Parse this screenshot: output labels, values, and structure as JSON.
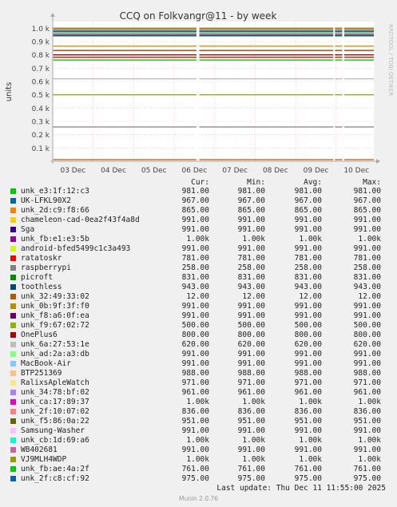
{
  "title": "CCQ on Folkvangr@11 - by week",
  "ylabel": "units",
  "side_text": "RRDTOOL / TOBI OETIKER",
  "legend_headers": {
    "cur": "Cur:",
    "min": "Min:",
    "avg": "Avg:",
    "max": "Max:"
  },
  "legend": [
    {
      "name": "unk_e3:1f:12:c3",
      "color": "#00cc00",
      "cur": "981.00",
      "min": "981.00",
      "avg": "981.00",
      "max": "981.00"
    },
    {
      "name": "UK-LFKL90X2",
      "color": "#0066b3",
      "cur": "967.00",
      "min": "967.00",
      "avg": "967.00",
      "max": "967.00"
    },
    {
      "name": "unk_2d:c9:f8:66",
      "color": "#ff8000",
      "cur": "865.00",
      "min": "865.00",
      "avg": "865.00",
      "max": "865.00"
    },
    {
      "name": "chameleon-cad-0ea2f43f4a8d",
      "color": "#ffcc00",
      "cur": "991.00",
      "min": "991.00",
      "avg": "991.00",
      "max": "991.00"
    },
    {
      "name": "Sga",
      "color": "#330099",
      "cur": "991.00",
      "min": "991.00",
      "avg": "991.00",
      "max": "991.00"
    },
    {
      "name": "unk_fb:e1:e3:5b",
      "color": "#990099",
      "cur": "1.00k",
      "min": "1.00k",
      "avg": "1.00k",
      "max": "1.00k"
    },
    {
      "name": "android-bfed5499c1c3a493",
      "color": "#ccff00",
      "cur": "991.00",
      "min": "991.00",
      "avg": "991.00",
      "max": "991.00"
    },
    {
      "name": "ratatoskr",
      "color": "#ff0000",
      "cur": "781.00",
      "min": "781.00",
      "avg": "781.00",
      "max": "781.00"
    },
    {
      "name": "raspberrypi",
      "color": "#808080",
      "cur": "258.00",
      "min": "258.00",
      "avg": "258.00",
      "max": "258.00"
    },
    {
      "name": "picroft",
      "color": "#008f00",
      "cur": "831.00",
      "min": "831.00",
      "avg": "831.00",
      "max": "831.00"
    },
    {
      "name": "toothless",
      "color": "#00487d",
      "cur": "943.00",
      "min": "943.00",
      "avg": "943.00",
      "max": "943.00"
    },
    {
      "name": "unk_32:49:33:02",
      "color": "#b35a00",
      "cur": "12.00",
      "min": "12.00",
      "avg": "12.00",
      "max": "12.00"
    },
    {
      "name": "unk_0b:9f:3f:f0",
      "color": "#b38f00",
      "cur": "991.00",
      "min": "991.00",
      "avg": "991.00",
      "max": "991.00"
    },
    {
      "name": "unk_f8:a6:0f:ea",
      "color": "#6b006b",
      "cur": "991.00",
      "min": "991.00",
      "avg": "991.00",
      "max": "991.00"
    },
    {
      "name": "unk_f9:67:02:72",
      "color": "#8fb300",
      "cur": "500.00",
      "min": "500.00",
      "avg": "500.00",
      "max": "500.00"
    },
    {
      "name": "OnePlus6",
      "color": "#b30000",
      "cur": "800.00",
      "min": "800.00",
      "avg": "800.00",
      "max": "800.00"
    },
    {
      "name": "unk_6a:27:53:1e",
      "color": "#bebebe",
      "cur": "620.00",
      "min": "620.00",
      "avg": "620.00",
      "max": "620.00"
    },
    {
      "name": "unk_ad:2a:a3:db",
      "color": "#80ff80",
      "cur": "991.00",
      "min": "991.00",
      "avg": "991.00",
      "max": "991.00"
    },
    {
      "name": "MacBook-Air",
      "color": "#80c9ff",
      "cur": "991.00",
      "min": "991.00",
      "avg": "991.00",
      "max": "991.00"
    },
    {
      "name": "BTP251369",
      "color": "#ffc080",
      "cur": "988.00",
      "min": "988.00",
      "avg": "988.00",
      "max": "988.00"
    },
    {
      "name": "RalixsApleWatch",
      "color": "#ffe680",
      "cur": "971.00",
      "min": "971.00",
      "avg": "971.00",
      "max": "971.00"
    },
    {
      "name": "unk_34:78:bf:02",
      "color": "#aa80ff",
      "cur": "961.00",
      "min": "961.00",
      "avg": "961.00",
      "max": "961.00"
    },
    {
      "name": "unk_ca:17:89:37",
      "color": "#ee00cc",
      "cur": "1.00k",
      "min": "1.00k",
      "avg": "1.00k",
      "max": "1.00k"
    },
    {
      "name": "unk_2f:10:07:02",
      "color": "#ff8080",
      "cur": "836.00",
      "min": "836.00",
      "avg": "836.00",
      "max": "836.00"
    },
    {
      "name": "unk_f5:86:0a:22",
      "color": "#666600",
      "cur": "951.00",
      "min": "951.00",
      "avg": "951.00",
      "max": "951.00"
    },
    {
      "name": "Samsung-Washer",
      "color": "#ffbfff",
      "cur": "991.00",
      "min": "991.00",
      "avg": "991.00",
      "max": "991.00"
    },
    {
      "name": "unk_cb:1d:69:a6",
      "color": "#00ffcc",
      "cur": "1.00k",
      "min": "1.00k",
      "avg": "1.00k",
      "max": "1.00k"
    },
    {
      "name": "WB402681",
      "color": "#cc6699",
      "cur": "991.00",
      "min": "991.00",
      "avg": "991.00",
      "max": "991.00"
    },
    {
      "name": "VJ9MLH4WDP",
      "color": "#999900",
      "cur": "1.00k",
      "min": "1.00k",
      "avg": "1.00k",
      "max": "1.00k"
    },
    {
      "name": "unk_fb:ae:4a:2f",
      "color": "#00cc00",
      "cur": "761.00",
      "min": "761.00",
      "avg": "761.00",
      "max": "761.00"
    },
    {
      "name": "unk_2f:c8:cf:92",
      "color": "#0066b3",
      "cur": "975.00",
      "min": "975.00",
      "avg": "975.00",
      "max": "975.00"
    }
  ],
  "last_update": "Last update: Thu Dec 11 11:55:00 2025",
  "munin_version": "Munin 2.0.76",
  "chart_data": {
    "type": "line",
    "title": "CCQ on Folkvangr@11 - by week",
    "ylabel": "units",
    "ylim": [
      0,
      1050
    ],
    "yticks": [
      {
        "v": 100,
        "label": "0.1 k"
      },
      {
        "v": 200,
        "label": "0.2 k"
      },
      {
        "v": 300,
        "label": "0.3 k"
      },
      {
        "v": 400,
        "label": "0.4 k"
      },
      {
        "v": 500,
        "label": "0.5 k"
      },
      {
        "v": 600,
        "label": "0.6 k"
      },
      {
        "v": 700,
        "label": "0.7 k"
      },
      {
        "v": 800,
        "label": "0.8 k"
      },
      {
        "v": 900,
        "label": "0.9 k"
      },
      {
        "v": 1000,
        "label": "1.0 k"
      }
    ],
    "xrange": [
      0,
      7.93
    ],
    "xticks": [
      {
        "v": 0.5,
        "label": "03 Dec"
      },
      {
        "v": 1.5,
        "label": "04 Dec"
      },
      {
        "v": 2.5,
        "label": "05 Dec"
      },
      {
        "v": 3.5,
        "label": "06 Dec"
      },
      {
        "v": 4.5,
        "label": "07 Dec"
      },
      {
        "v": 5.5,
        "label": "08 Dec"
      },
      {
        "v": 6.5,
        "label": "09 Dec"
      },
      {
        "v": 7.5,
        "label": "10 Dec"
      }
    ],
    "day_boundaries": [
      0,
      1,
      2,
      3,
      4,
      5,
      6,
      7
    ],
    "gaps": [
      [
        3.55,
        3.62
      ],
      [
        6.93,
        6.97
      ],
      [
        7.15,
        7.2
      ]
    ],
    "grid": true
  }
}
